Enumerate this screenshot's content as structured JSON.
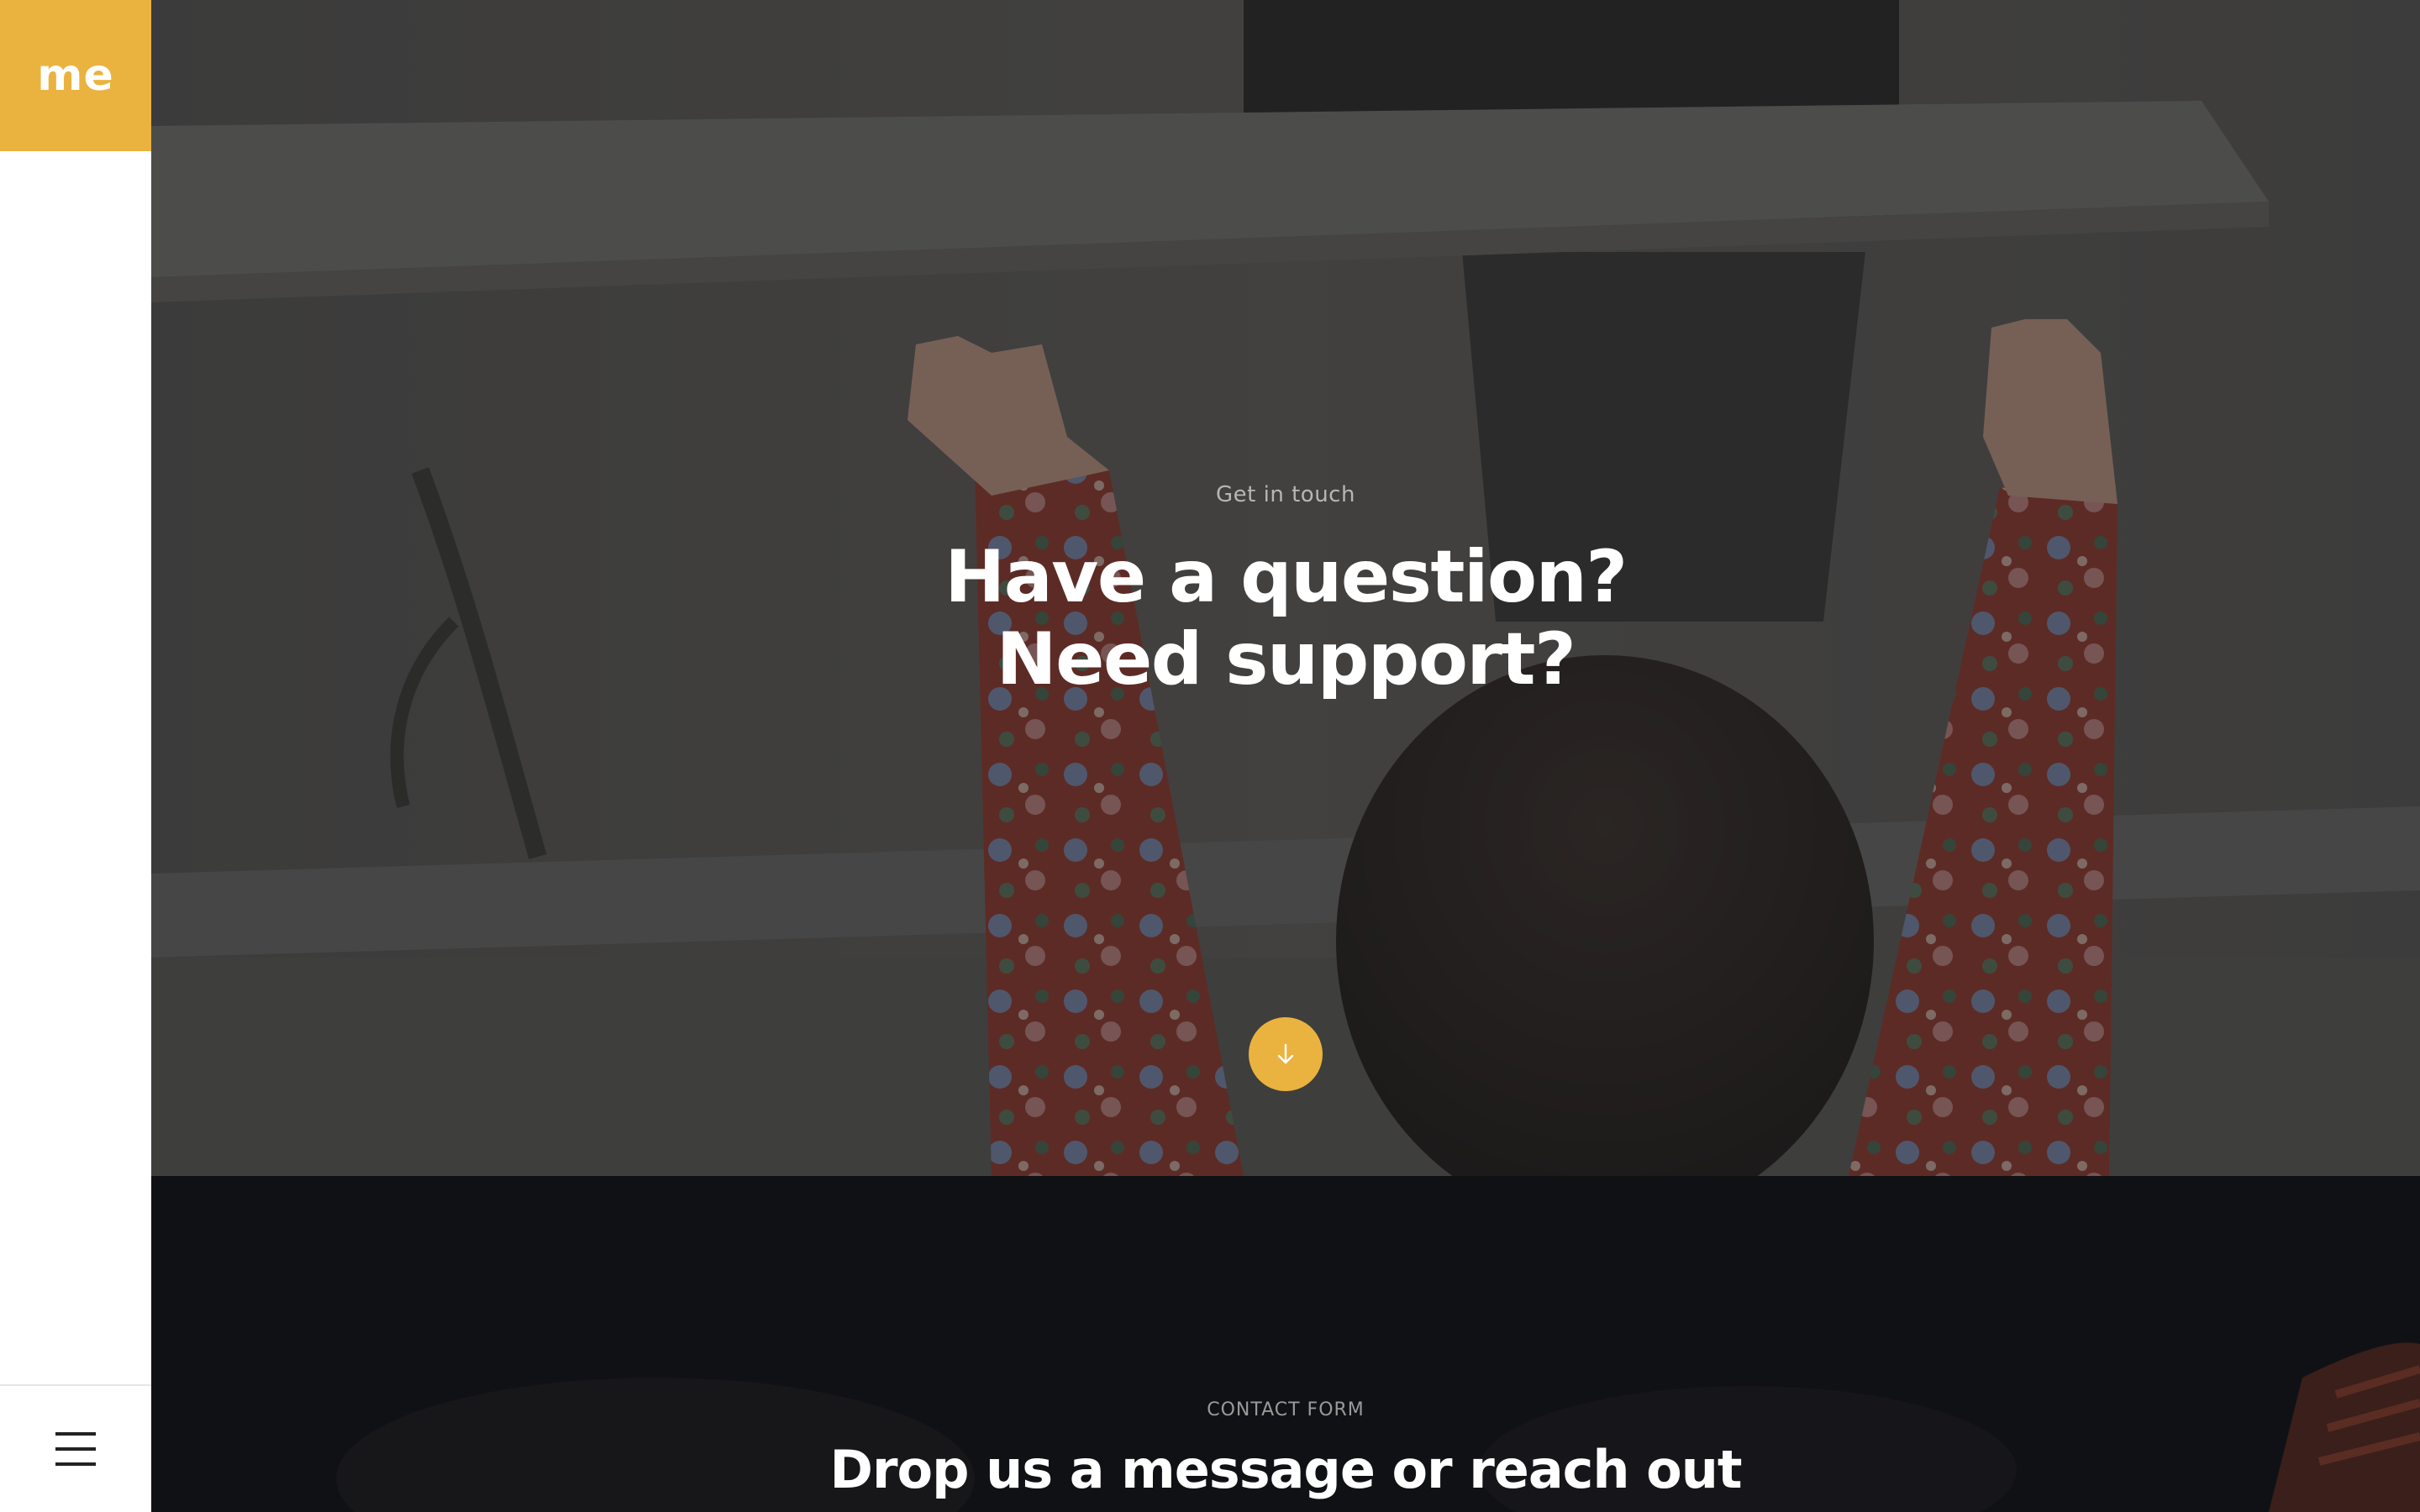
{
  "brand": {
    "logo_text": "me",
    "accent_color": "#eab33f"
  },
  "sidebar": {
    "menu_icon": "hamburger-menu-icon"
  },
  "hero": {
    "eyebrow": "Get in touch",
    "title": "Have a question? Need support?",
    "scroll_icon": "arrow-down-icon"
  },
  "contact": {
    "label": "CONTACT FORM",
    "title": "Drop us a message or reach out"
  }
}
